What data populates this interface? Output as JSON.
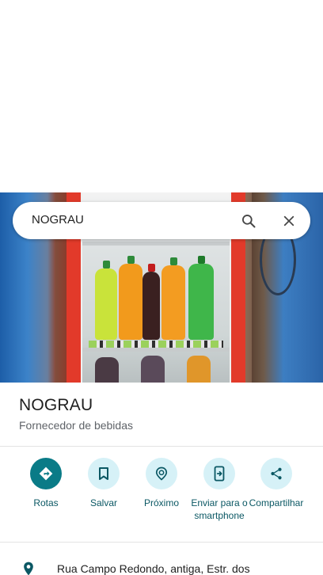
{
  "search": {
    "query": "NOGRAU"
  },
  "place": {
    "name": "NOGRAU",
    "category": "Fornecedor de bebidas"
  },
  "actions": [
    {
      "label": "Rotas",
      "icon": "directions-icon"
    },
    {
      "label": "Salvar",
      "icon": "bookmark-icon"
    },
    {
      "label": "Próximo",
      "icon": "nearby-icon"
    },
    {
      "label": "Enviar para o smartphone",
      "icon": "send-to-phone-icon"
    },
    {
      "label": "Compartilhar",
      "icon": "share-icon"
    }
  ],
  "address": {
    "line": "Rua Campo Redondo, antiga, Estr. dos"
  },
  "colors": {
    "primary_action": "#0a7b87",
    "action_bg": "#d6f1f7",
    "action_text": "#0b5864",
    "secondary_text": "#5f6368"
  }
}
